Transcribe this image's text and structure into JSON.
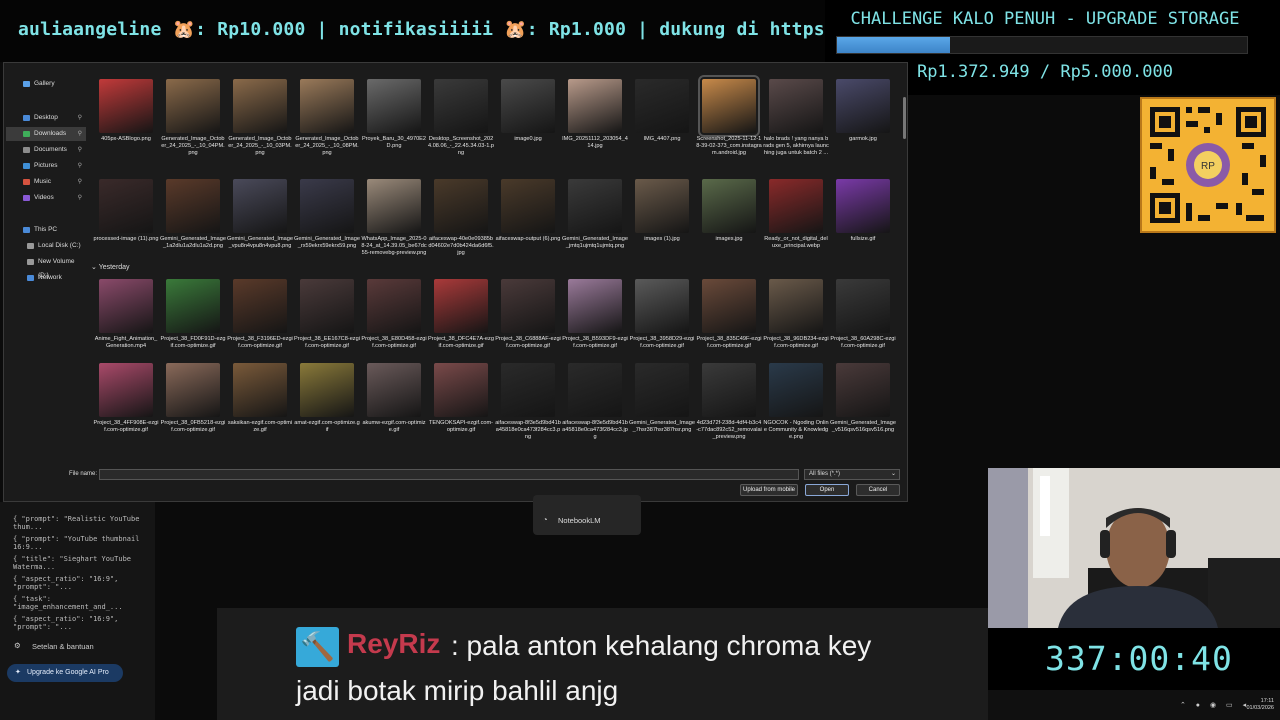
{
  "ticker": {
    "text": "auliaangeline 🐹: Rp10.000 | notifikasiiiii 🐹: Rp1.000 |  dukung di https:"
  },
  "challenge": {
    "title": "CHALLENGE KALO PENUH - UPGRADE STORAGE",
    "amount": "Rp1.372.949 / Rp5.000.000",
    "progress_fraction": 0.275
  },
  "dialog": {
    "nav": [
      {
        "label": "Gallery",
        "icon": "gallery-icon",
        "color": "#5aa0e8"
      },
      {
        "label": "Desktop",
        "icon": "desktop-icon",
        "color": "#4a8ad8"
      },
      {
        "label": "Downloads",
        "icon": "downloads-icon",
        "color": "#3fae5a"
      },
      {
        "label": "Documents",
        "icon": "documents-icon",
        "color": "#8c8c8c"
      },
      {
        "label": "Pictures",
        "icon": "pictures-icon",
        "color": "#3f8fd6"
      },
      {
        "label": "Music",
        "icon": "music-icon",
        "color": "#d6533f"
      },
      {
        "label": "Videos",
        "icon": "videos-icon",
        "color": "#8a5ad6"
      },
      {
        "label": "This PC",
        "icon": "pc-icon",
        "color": "#4a8ad8"
      },
      {
        "label": "Local Disk (C:)",
        "icon": "disk-icon",
        "color": "#999999"
      },
      {
        "label": "New Volume (D:)",
        "icon": "disk-icon",
        "color": "#999999"
      },
      {
        "label": "Network",
        "icon": "network-icon",
        "color": "#4a8ad8"
      }
    ],
    "group_yesterday": "Yesterday",
    "files_row1": [
      {
        "name": "405px-ASBlogo.png",
        "color": "#c23a3a"
      },
      {
        "name": "Generated_Image_October_24_2025_-_10_04PM.png",
        "color": "#8a6a4a"
      },
      {
        "name": "Generated_Image_October_24_2025_-_10_03PM.png",
        "color": "#8a6a4a"
      },
      {
        "name": "Generated_Image_October_24_2025_-_10_08PM.png",
        "color": "#9a7a5a"
      },
      {
        "name": "Proyek_Baru_30_4970E2D.png",
        "color": "#6a6a6a"
      },
      {
        "name": "Desktop_Screenshot_2024.08.06_-_22.45.34.03-1.png",
        "color": "#3a3a3a"
      },
      {
        "name": "image0.jpg",
        "color": "#4a4a4a"
      },
      {
        "name": "IMG_20251112_203054_414.jpg",
        "color": "#b89a8a"
      },
      {
        "name": "IMG_4407.png",
        "color": "#2a2a2a"
      },
      {
        "name": "Screenshot_2025-11-12-18-39-02-373_com.instagram.android.jpg",
        "color": "#c88a4a"
      },
      {
        "name": "halo brads ! yang nanya brads gen 5, akhirnya launching juga untuk batch 2 ...",
        "color": "#5a4a4a"
      },
      {
        "name": "garmok.jpg",
        "color": "#4a4a6a"
      }
    ],
    "files_row2": [
      {
        "name": "processed-image (11).png",
        "color": "#3a2a2a"
      },
      {
        "name": "Gemini_Generated_Image_1a2dlu1a2dlu1a2d.png",
        "color": "#5a3a2a"
      },
      {
        "name": "Gemini_Generated_Image_vpu8n4vpu8n4vpu8.png",
        "color": "#4a4a5a"
      },
      {
        "name": "Gemini_Generated_Image_rx59ekrx59ekrx59.png",
        "color": "#3a3a4a"
      },
      {
        "name": "WhatsApp_Image_2025-08-24_at_14.39.05_be67dc55-removebg-preview.png",
        "color": "#9a8a7a"
      },
      {
        "name": "aifaceswap-40e0e09385bd04602e7d0b424da6d6f5.jpg",
        "color": "#4a3a2a"
      },
      {
        "name": "aifaceswap-output (6).png",
        "color": "#4a3a2a"
      },
      {
        "name": "Gemini_Generated_Image_jmtq1ujmtq1ujmtq.png",
        "color": "#3a3a3a"
      },
      {
        "name": "images (1).jpg",
        "color": "#6a5a4a"
      },
      {
        "name": "images.jpg",
        "color": "#5a6a4a"
      },
      {
        "name": "Ready_or_not_digital_deluxe_principal.webp",
        "color": "#8a2a2a"
      },
      {
        "name": "fullsize.gif",
        "color": "#7a3aa8"
      }
    ],
    "files_row3": [
      {
        "name": "Anime_Fight_Animation_Generation.mp4",
        "color": "#8a4a6a"
      },
      {
        "name": "Project_38_FD0F91D-ezgif.com-optimize.gif",
        "color": "#3a7a3a"
      },
      {
        "name": "Project_38_F3196ED-ezgif.com-optimize.gif",
        "color": "#5a3a2a"
      },
      {
        "name": "Project_38_EE167C8-ezgif.com-optimize.gif",
        "color": "#4a3a3a"
      },
      {
        "name": "Project_38_E80D458-ezgif.com-optimize.gif",
        "color": "#5a3a3a"
      },
      {
        "name": "Project_38_DFC4E7A-ezgif.com-optimize.gif",
        "color": "#aa3a3a"
      },
      {
        "name": "Project_38_C6888AF-ezgif.com-optimize.gif",
        "color": "#4a3a3a"
      },
      {
        "name": "Project_38_B593DF9-ezgif.com-optimize.gif",
        "color": "#9a7a9a"
      },
      {
        "name": "Project_38_3958D29-ezgif.com-optimize.gif",
        "color": "#5a5a5a"
      },
      {
        "name": "Project_38_835C49F-ezgif.com-optimize.gif",
        "color": "#6a4a3a"
      },
      {
        "name": "Project_38_96DB234-ezgif.com-optimize.gif",
        "color": "#6a5a4a"
      },
      {
        "name": "Project_38_60A298C-ezgif.com-optimize.gif",
        "color": "#3a3a3a"
      }
    ],
    "files_row4": [
      {
        "name": "Project_38_4FF908E-ezgif.com-optimize.gif",
        "color": "#aa4a6a"
      },
      {
        "name": "Project_38_0FB5218-ezgif.com-optimize.gif",
        "color": "#8a6a5a"
      },
      {
        "name": "saksikan-ezgif.com-optimize.gif",
        "color": "#7a5a3a"
      },
      {
        "name": "amat-ezgif.com-optimize.gif",
        "color": "#8a7a3a"
      },
      {
        "name": "akumw-ezgif.com-optimize.gif",
        "color": "#6a5a5a"
      },
      {
        "name": "TENGOKSAPI-ezgif.com-optimize.gif",
        "color": "#7a4a4a"
      },
      {
        "name": "aifaceswap-8f3e5d9bd41ba45818e0ca473f284cc3.png",
        "color": "#2a2a2a"
      },
      {
        "name": "aifaceswap-8f3e5d9bd41ba45818e0ca473f284cc3.jpg",
        "color": "#2a2a2a"
      },
      {
        "name": "Gemini_Generated_Image_7hsr387hsr387hsr.png",
        "color": "#2a2a2a"
      },
      {
        "name": "4d23d72f-238d-4df4-b3c4-c77dac892c52_removalai_preview.png",
        "color": "#3a3a3a"
      },
      {
        "name": "NGOCOK - Ngoding Online Community & Knowledge.png",
        "color": "#2a3a4a"
      },
      {
        "name": "Gemini_Generated_Image_v516qsv516qsv516.png",
        "color": "#4a3a3a"
      }
    ],
    "file_name_label": "File name:",
    "file_name_value": "",
    "filter_value": "All files (*.*)",
    "upload_label": "Upload from mobile",
    "open_label": "Open",
    "cancel_label": "Cancel"
  },
  "sidebar": {
    "prompts": [
      "{ \"prompt\": \"Realistic YouTube thum...",
      "{ \"prompt\": \"YouTube thumbnail 16:9...",
      "{ \"title\": \"Sieghart YouTube Waterma...",
      "{ \"aspect_ratio\": \"16:9\", \"prompt\": \"...",
      "{ \"task\": \"image_enhancement_and_...",
      "{ \"aspect_ratio\": \"16:9\", \"prompt\": \"..."
    ],
    "help": "Setelan & bantuan",
    "upgrade": "Upgrade ke Google AI Pro"
  },
  "notebook": {
    "label": "NotebookLM"
  },
  "chat": {
    "user": "ReyRiz",
    "line1": ": pala anton kehalang chroma key",
    "line2": "jadi botak mirip bahlil anjg"
  },
  "timer": "337:00:40",
  "taskbar": {
    "time": "17:11",
    "date": "01/03/2026"
  }
}
